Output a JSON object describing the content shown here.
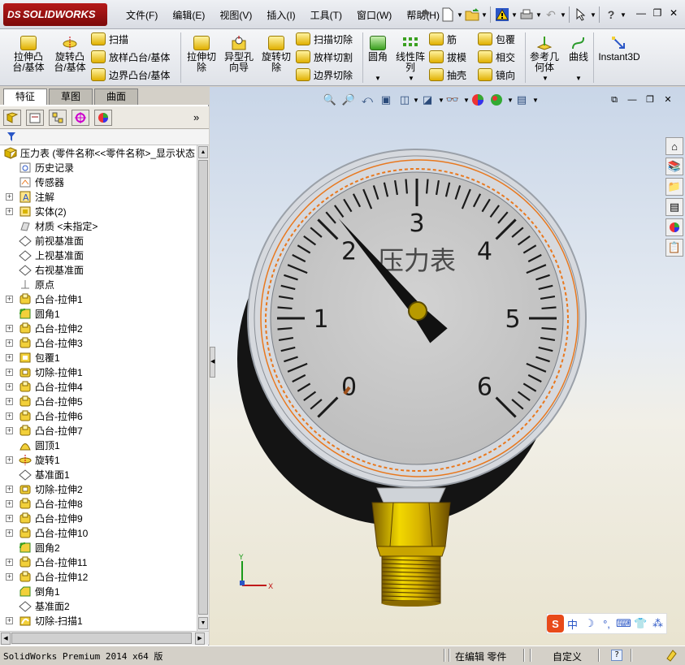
{
  "app": {
    "logo_text": "SOLIDWORKS",
    "logo_prefix": "DS"
  },
  "menu": {
    "items": [
      "文件(F)",
      "编辑(E)",
      "视图(V)",
      "插入(I)",
      "工具(T)",
      "窗口(W)",
      "帮助(H)"
    ]
  },
  "commands": {
    "extrude_boss": "拉伸凸\n台/基体",
    "revolve_boss": "旋转凸\n台/基体",
    "sweep": "扫描",
    "loft": "放样凸台/基体",
    "boundary": "边界凸台/基体",
    "extrude_cut": "拉伸切\n除",
    "hole_wizard": "异型孔\n向导",
    "revolve_cut": "旋转切\n除",
    "sweep_cut": "扫描切除",
    "loft_cut": "放样切割",
    "boundary_cut": "边界切除",
    "fillet": "圆角",
    "linear_pattern": "线性阵\n列",
    "rib": "筋",
    "draft": "拔模",
    "shell": "抽壳",
    "wrap": "包覆",
    "intersect": "相交",
    "mirror": "镜向",
    "ref_geometry": "参考几\n何体",
    "curves": "曲线",
    "instant3d": "Instant3D"
  },
  "panel": {
    "tabs": [
      "特征",
      "草图",
      "曲面"
    ],
    "active_tab": "特征",
    "root_label": "压力表  (零件名称<<零件名称>_显示状态",
    "tree": [
      {
        "label": "历史记录",
        "icon": "history-icon",
        "expand": false
      },
      {
        "label": "传感器",
        "icon": "sensor-icon",
        "expand": false
      },
      {
        "label": "注解",
        "icon": "annotation-icon",
        "expand": true
      },
      {
        "label": "实体(2)",
        "icon": "solid-bodies-icon",
        "expand": true
      },
      {
        "label": "材质 <未指定>",
        "icon": "material-icon",
        "expand": false
      },
      {
        "label": "前视基准面",
        "icon": "plane-icon",
        "expand": false
      },
      {
        "label": "上视基准面",
        "icon": "plane-icon",
        "expand": false
      },
      {
        "label": "右视基准面",
        "icon": "plane-icon",
        "expand": false
      },
      {
        "label": "原点",
        "icon": "origin-icon",
        "expand": false
      },
      {
        "label": "凸台-拉伸1",
        "icon": "extrude-icon",
        "expand": true
      },
      {
        "label": "圆角1",
        "icon": "fillet-icon",
        "expand": false
      },
      {
        "label": "凸台-拉伸2",
        "icon": "extrude-icon",
        "expand": true
      },
      {
        "label": "凸台-拉伸3",
        "icon": "extrude-icon",
        "expand": true
      },
      {
        "label": "包覆1",
        "icon": "wrap-icon",
        "expand": true
      },
      {
        "label": "切除-拉伸1",
        "icon": "cut-extrude-icon",
        "expand": true
      },
      {
        "label": "凸台-拉伸4",
        "icon": "extrude-icon",
        "expand": true
      },
      {
        "label": "凸台-拉伸5",
        "icon": "extrude-icon",
        "expand": true
      },
      {
        "label": "凸台-拉伸6",
        "icon": "extrude-icon",
        "expand": true
      },
      {
        "label": "凸台-拉伸7",
        "icon": "extrude-icon",
        "expand": true
      },
      {
        "label": "圆顶1",
        "icon": "dome-icon",
        "expand": false
      },
      {
        "label": "旋转1",
        "icon": "revolve-icon",
        "expand": true
      },
      {
        "label": "基准面1",
        "icon": "plane-icon",
        "expand": false
      },
      {
        "label": "切除-拉伸2",
        "icon": "cut-extrude-icon",
        "expand": true
      },
      {
        "label": "凸台-拉伸8",
        "icon": "extrude-icon",
        "expand": true
      },
      {
        "label": "凸台-拉伸9",
        "icon": "extrude-icon",
        "expand": true
      },
      {
        "label": "凸台-拉伸10",
        "icon": "extrude-icon",
        "expand": true
      },
      {
        "label": "圆角2",
        "icon": "fillet-icon",
        "expand": false
      },
      {
        "label": "凸台-拉伸11",
        "icon": "extrude-icon",
        "expand": true
      },
      {
        "label": "凸台-拉伸12",
        "icon": "extrude-icon",
        "expand": true
      },
      {
        "label": "倒角1",
        "icon": "chamfer-icon",
        "expand": false
      },
      {
        "label": "基准面2",
        "icon": "plane-icon",
        "expand": false
      },
      {
        "label": "切除-扫描1",
        "icon": "cut-sweep-icon",
        "expand": true
      }
    ]
  },
  "gauge": {
    "title_text": "压力表",
    "scale_labels": [
      "0",
      "1",
      "2",
      "3",
      "4",
      "5",
      "6"
    ],
    "needle_value": 2.1,
    "colors": {
      "face": "#c8c8c8",
      "ticks": "#1a1a1a",
      "accent_ring": "#e8781e",
      "brass": "#d8b400",
      "case": "#151515"
    }
  },
  "triad": {
    "x": "X",
    "y": "Y"
  },
  "ime": {
    "logo": "S",
    "lang": "中"
  },
  "status": {
    "version": "SolidWorks Premium 2014 x64 版",
    "mode": "在编辑 零件",
    "units": "自定义",
    "help": "?"
  }
}
